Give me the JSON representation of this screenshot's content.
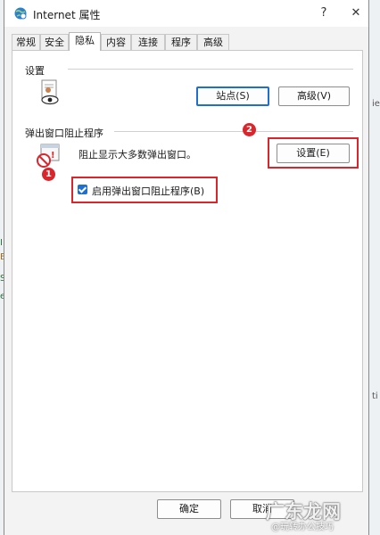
{
  "dialog": {
    "title": "Internet 属性",
    "help": "?",
    "close": "✕"
  },
  "tabs": [
    {
      "label": "常规"
    },
    {
      "label": "安全"
    },
    {
      "label": "隐私",
      "active": true
    },
    {
      "label": "内容"
    },
    {
      "label": "连接"
    },
    {
      "label": "程序"
    },
    {
      "label": "高级"
    }
  ],
  "settings_group": {
    "label": "设置",
    "sites_button": "站点(S)",
    "advanced_button": "高级(V)"
  },
  "popup_group": {
    "label": "弹出窗口阻止程序",
    "description": "阻止显示大多数弹出窗口。",
    "settings_button": "设置(E)",
    "enable_checkbox_label": "启用弹出窗口阻止程序(B)",
    "enable_checked": true
  },
  "annotations": {
    "badge_1": "1",
    "badge_2": "2",
    "color": "#d9262c"
  },
  "footer": {
    "ok_button": "确定",
    "cancel_button": "取消"
  },
  "background_fragments": [
    "ie",
    "ti",
    "I",
    "E",
    "S",
    "e"
  ],
  "watermark": {
    "brand": "广东龙网",
    "sub": "@玩转办公技巧"
  }
}
